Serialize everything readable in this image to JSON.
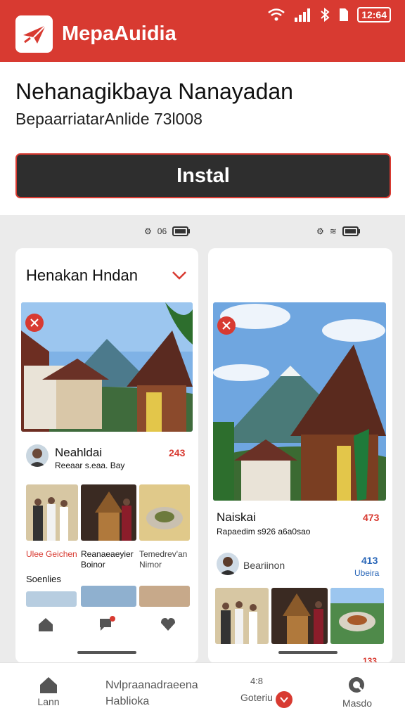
{
  "header": {
    "app_name": "MepaAuidia",
    "color": "#d83a31",
    "logo_icon": "paper-plane-icon"
  },
  "status_bar": {
    "time": "12:64"
  },
  "app": {
    "title": "Nehanagikbaya Nanayadan",
    "subtitle": "BepaarriatarAnlide 73l008",
    "install_label": "Instal"
  },
  "shot1": {
    "status": "06",
    "card_title": "Henakan Hndan",
    "post": {
      "name": "Neahldai",
      "meta": "Reeaar s.eaa. Bay",
      "count": "243"
    },
    "thumbs": [
      {
        "label": "Ulee Geichen"
      },
      {
        "label": "Reanaeaeyier Boinor"
      },
      {
        "label": "Temedrev'an Nimor"
      }
    ],
    "section": "Soenlies"
  },
  "shot2": {
    "post": {
      "name": "Naiskai",
      "meta": "Rapaedim s926 a6a0sao",
      "count": "473"
    },
    "user": {
      "name": "Beariinon",
      "count": "413",
      "link": "Ubeira"
    },
    "footer_count": "133"
  },
  "bottom_nav": [
    {
      "label": "Lann",
      "icon": "home-icon"
    },
    {
      "label": "Nvlpraanadraeena Hablioka",
      "icon": ""
    },
    {
      "label": "Goteriu",
      "sup": "4:8",
      "icon": "notification-icon"
    },
    {
      "label": "Masdo",
      "icon": "search-icon"
    }
  ]
}
